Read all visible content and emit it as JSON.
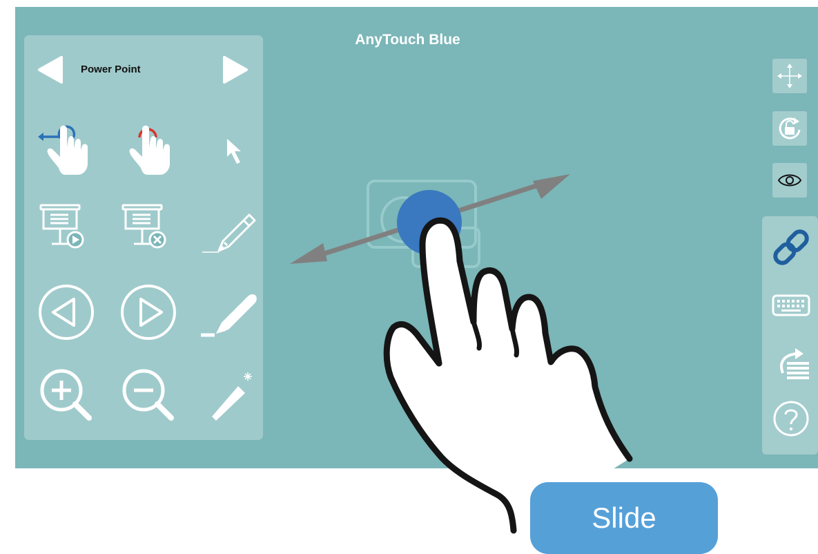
{
  "app": {
    "title": "AnyTouch Blue"
  },
  "mode_panel": {
    "mode_label": "Power Point"
  },
  "tools": [
    {
      "name": "swipe-back-gesture-icon"
    },
    {
      "name": "double-tap-gesture-icon"
    },
    {
      "name": "pointer-icon"
    },
    {
      "name": "start-presentation-icon"
    },
    {
      "name": "end-presentation-icon"
    },
    {
      "name": "pencil-icon"
    },
    {
      "name": "previous-slide-icon"
    },
    {
      "name": "next-slide-icon"
    },
    {
      "name": "highlighter-icon"
    },
    {
      "name": "zoom-in-icon"
    },
    {
      "name": "zoom-out-icon"
    },
    {
      "name": "laser-pointer-icon"
    }
  ],
  "right_toolbar": {
    "top": [
      {
        "name": "move-icon"
      },
      {
        "name": "rotation-lock-icon"
      },
      {
        "name": "eye-icon"
      }
    ],
    "bottom": [
      {
        "name": "link-icon"
      },
      {
        "name": "keyboard-icon"
      },
      {
        "name": "share-list-icon"
      },
      {
        "name": "help-icon"
      }
    ]
  },
  "gesture_demo": {
    "caption": "Slide"
  },
  "colors": {
    "background": "#7bb6b8",
    "accent_blue": "#3a78c0",
    "slide_button": "#56a0d8",
    "link_blue": "#1f5f9e"
  }
}
